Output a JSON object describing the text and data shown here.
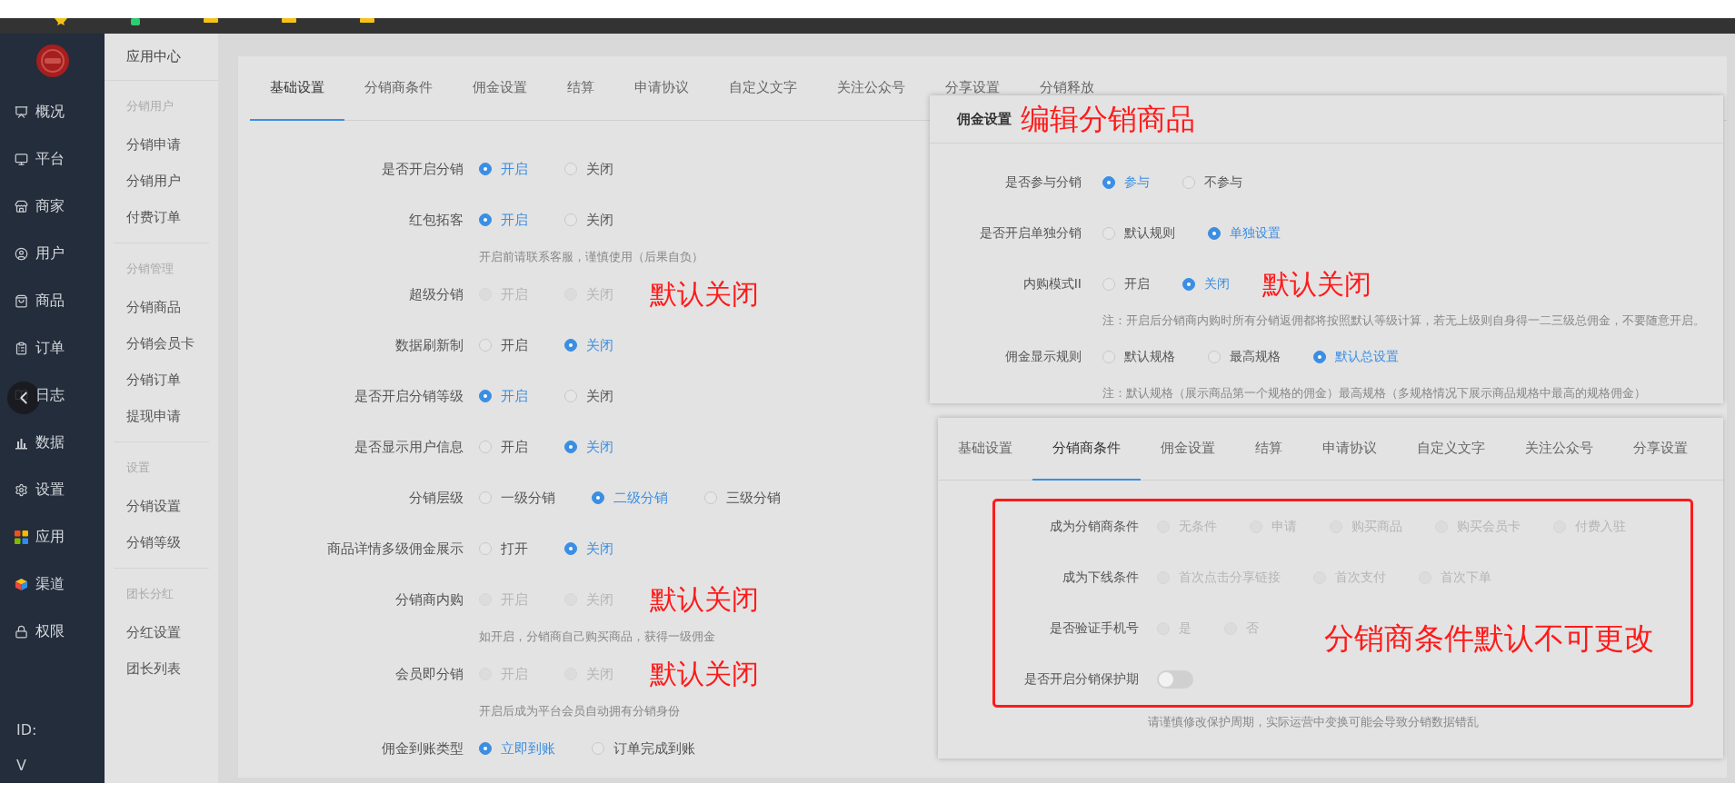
{
  "sidebar": {
    "items": [
      "概况",
      "平台",
      "商家",
      "用户",
      "商品",
      "订单",
      "日志",
      "数据",
      "设置",
      "应用",
      "渠道",
      "权限"
    ],
    "footer": [
      "ID:",
      "V"
    ]
  },
  "submenu": {
    "title": "应用中心",
    "groups": [
      {
        "heading": "分销用户",
        "items": [
          "分销申请",
          "分销用户",
          "付费订单"
        ]
      },
      {
        "heading": "分销管理",
        "items": [
          "分销商品",
          "分销会员卡",
          "分销订单",
          "提现申请"
        ]
      },
      {
        "heading": "设置",
        "items": [
          "分销设置",
          "分销等级"
        ]
      },
      {
        "heading": "团长分红",
        "items": [
          "分红设置",
          "团长列表"
        ]
      }
    ]
  },
  "main": {
    "tabs": [
      {
        "label": "基础设置",
        "selected": true
      },
      {
        "label": "分销商条件",
        "selected": false
      },
      {
        "label": "佣金设置",
        "selected": false
      },
      {
        "label": "结算",
        "selected": false
      },
      {
        "label": "申请协议",
        "selected": false
      },
      {
        "label": "自定义文字",
        "selected": false
      },
      {
        "label": "关注公众号",
        "selected": false
      },
      {
        "label": "分享设置",
        "selected": false
      },
      {
        "label": "分销释放",
        "selected": false
      }
    ],
    "rows": [
      {
        "label": "是否开启分销",
        "options": [
          {
            "label": "开启",
            "checked": true,
            "disabled": false
          },
          {
            "label": "关闭",
            "checked": false,
            "disabled": false
          }
        ]
      },
      {
        "label": "红包拓客",
        "options": [
          {
            "label": "开启",
            "checked": true,
            "disabled": false
          },
          {
            "label": "关闭",
            "checked": false,
            "disabled": false
          }
        ],
        "hint": "开启前请联系客服，谨慎使用（后果自负）"
      },
      {
        "label": "超级分销",
        "options": [
          {
            "label": "开启",
            "checked": false,
            "disabled": true
          },
          {
            "label": "关闭",
            "checked": false,
            "disabled": true
          }
        ],
        "annotation": "默认关闭"
      },
      {
        "label": "数据刷新制",
        "options": [
          {
            "label": "开启",
            "checked": false,
            "disabled": false
          },
          {
            "label": "关闭",
            "checked": true,
            "disabled": false
          }
        ]
      },
      {
        "label": "是否开启分销等级",
        "options": [
          {
            "label": "开启",
            "checked": true,
            "disabled": false
          },
          {
            "label": "关闭",
            "checked": false,
            "disabled": false
          }
        ]
      },
      {
        "label": "是否显示用户信息",
        "options": [
          {
            "label": "开启",
            "checked": false,
            "disabled": false
          },
          {
            "label": "关闭",
            "checked": true,
            "disabled": false
          }
        ]
      },
      {
        "label": "分销层级",
        "options": [
          {
            "label": "一级分销",
            "checked": false,
            "disabled": false
          },
          {
            "label": "二级分销",
            "checked": true,
            "disabled": false
          },
          {
            "label": "三级分销",
            "checked": false,
            "disabled": false
          }
        ]
      },
      {
        "label": "商品详情多级佣金展示",
        "options": [
          {
            "label": "打开",
            "checked": false,
            "disabled": false
          },
          {
            "label": "关闭",
            "checked": true,
            "disabled": false
          }
        ]
      },
      {
        "label": "分销商内购",
        "options": [
          {
            "label": "开启",
            "checked": false,
            "disabled": true
          },
          {
            "label": "关闭",
            "checked": false,
            "disabled": true
          }
        ],
        "hint": "如开启，分销商自己购买商品，获得一级佣金",
        "annotation": "默认关闭"
      },
      {
        "label": "会员即分销",
        "options": [
          {
            "label": "开启",
            "checked": false,
            "disabled": true
          },
          {
            "label": "关闭",
            "checked": false,
            "disabled": true
          }
        ],
        "hint": "开启后成为平台会员自动拥有分销身份",
        "annotation": "默认关闭"
      },
      {
        "label": "佣金到账类型",
        "options": [
          {
            "label": "立即到账",
            "checked": true,
            "disabled": false
          },
          {
            "label": "订单完成到账",
            "checked": false,
            "disabled": false
          }
        ]
      }
    ]
  },
  "commission_panel": {
    "title": "佣金设置",
    "annotation": "编辑分销商品",
    "rows": [
      {
        "label": "是否参与分销",
        "options": [
          {
            "label": "参与",
            "checked": true,
            "disabled": false
          },
          {
            "label": "不参与",
            "checked": false,
            "disabled": false
          }
        ]
      },
      {
        "label": "是否开启单独分销",
        "options": [
          {
            "label": "默认规则",
            "checked": false,
            "disabled": false
          },
          {
            "label": "单独设置",
            "checked": true,
            "disabled": false
          }
        ]
      },
      {
        "label": "内购模式II",
        "options": [
          {
            "label": "开启",
            "checked": false,
            "disabled": false
          },
          {
            "label": "关闭",
            "checked": true,
            "disabled": false
          }
        ],
        "annotation": "默认关闭",
        "hint": "注：开启后分销商内购时所有分销返佣都将按照默认等级计算，若无上级则自身得一二三级总佣金，不要随意开启。"
      },
      {
        "label": "佣金显示规则",
        "options": [
          {
            "label": "默认规格",
            "checked": false,
            "disabled": false
          },
          {
            "label": "最高规格",
            "checked": false,
            "disabled": false
          },
          {
            "label": "默认总设置",
            "checked": true,
            "disabled": false
          }
        ],
        "hint": "注：默认规格（展示商品第一个规格的佣金）最高规格（多规格情况下展示商品规格中最高的规格佣金）"
      }
    ]
  },
  "conditions_panel": {
    "tabs": [
      {
        "label": "基础设置",
        "selected": false
      },
      {
        "label": "分销商条件",
        "selected": true
      },
      {
        "label": "佣金设置",
        "selected": false
      },
      {
        "label": "结算",
        "selected": false
      },
      {
        "label": "申请协议",
        "selected": false
      },
      {
        "label": "自定义文字",
        "selected": false
      },
      {
        "label": "关注公众号",
        "selected": false
      },
      {
        "label": "分享设置",
        "selected": false
      }
    ],
    "rows": [
      {
        "kind": "radio",
        "label": "成为分销商条件",
        "options": [
          {
            "label": "无条件",
            "checked": false,
            "disabled": true
          },
          {
            "label": "申请",
            "checked": false,
            "disabled": true
          },
          {
            "label": "购买商品",
            "checked": false,
            "disabled": true
          },
          {
            "label": "购买会员卡",
            "checked": false,
            "disabled": true
          },
          {
            "label": "付费入驻",
            "checked": false,
            "disabled": true
          }
        ]
      },
      {
        "kind": "radio",
        "label": "成为下线条件",
        "options": [
          {
            "label": "首次点击分享链接",
            "checked": false,
            "disabled": true
          },
          {
            "label": "首次支付",
            "checked": false,
            "disabled": true
          },
          {
            "label": "首次下单",
            "checked": false,
            "disabled": true
          }
        ]
      },
      {
        "kind": "radio",
        "label": "是否验证手机号",
        "options": [
          {
            "label": "是",
            "checked": false,
            "disabled": true
          },
          {
            "label": "否",
            "checked": false,
            "disabled": true
          }
        ]
      },
      {
        "kind": "toggle",
        "label": "是否开启分销保护期",
        "on": false
      }
    ],
    "hint": "请谨慎修改保护周期，实际运营中变换可能会导致分销数据错乱",
    "annotation": "分销商条件默认不可更改"
  }
}
